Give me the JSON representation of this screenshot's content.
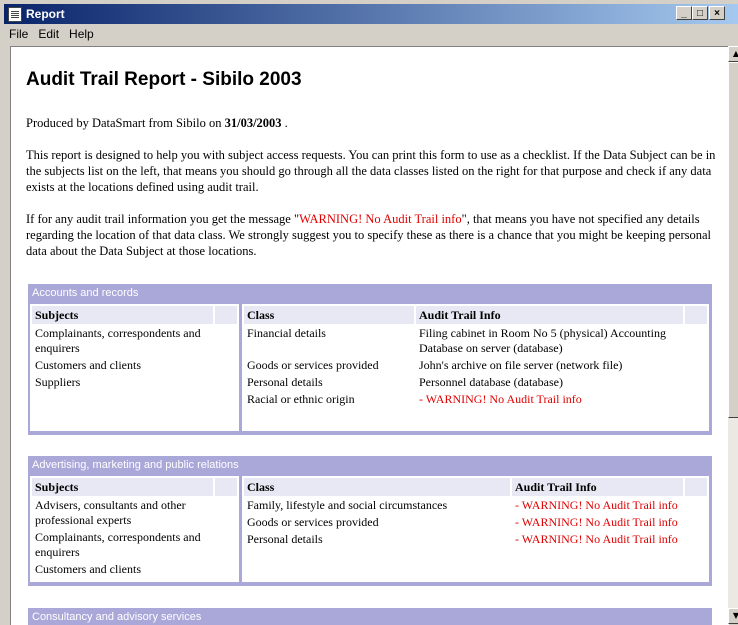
{
  "window": {
    "title": "Report"
  },
  "menu": [
    "File",
    "Edit",
    "Help"
  ],
  "report": {
    "heading": "Audit Trail Report - Sibilo 2003",
    "produced_prefix": "Produced by DataSmart from Sibilo on ",
    "produced_date": "31/03/2003",
    "produced_suffix": " .",
    "intro": "This report is designed to help you with subject access requests. You can print this form to use as a checklist. If the Data Subject can be in the subjects list on the left, that means you should go through all the data classes listed on the right for that purpose and check if any data exists at the locations defined using audit trail.",
    "warning_prefix": "If for any audit trail information you get the message \"",
    "warning_text": "WARNING! No Audit Trail info",
    "warning_suffix": "\", that means you have not specified any details regarding the location of that data class. We strongly suggest you to specify these as there is a chance that you might be keeping personal data about the Data Subject at those locations."
  },
  "columns": {
    "subjects": "Subjects",
    "class": "Class",
    "audit": "Audit Trail Info"
  },
  "sections": [
    {
      "title": "Accounts and records",
      "subjects": [
        "Complainants, correspondents and enquirers",
        "Customers and clients",
        "Suppliers"
      ],
      "rows": [
        {
          "class": "Financial details",
          "info": "Filing cabinet in Room No 5 (physical) Accounting Database on server (database)"
        },
        {
          "class": "Goods or services provided",
          "info": "John's archive on file server (network file)"
        },
        {
          "class": "Personal details",
          "info": "Personnel database (database)"
        },
        {
          "class": "Racial or ethnic origin",
          "info": "- WARNING! No Audit Trail info"
        }
      ]
    },
    {
      "title": "Advertising, marketing and public relations",
      "subjects": [
        "Advisers, consultants and other professional experts",
        "Complainants, correspondents and enquirers",
        "Customers and clients"
      ],
      "rows": [
        {
          "class": "Family, lifestyle and social circumstances",
          "info": "- WARNING! No Audit Trail info"
        },
        {
          "class": "Goods or services provided",
          "info": "- WARNING! No Audit Trail info"
        },
        {
          "class": "Personal details",
          "info": "- WARNING! No Audit Trail info"
        }
      ]
    },
    {
      "title": "Consultancy and advisory services"
    }
  ],
  "colors": {
    "section_header": "#aaa7d9",
    "warning": "#e00000",
    "titlebar": "#0a246a"
  }
}
